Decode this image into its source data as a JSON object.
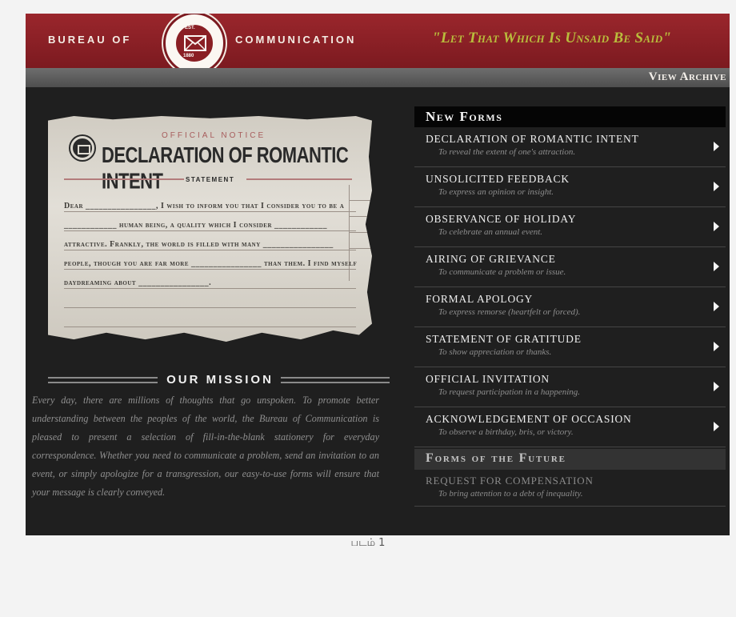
{
  "header": {
    "brand_left": "BUREAU OF",
    "brand_right": "COMMUNICATION",
    "seal": {
      "ring_text": "BUREAU OF COMMUNICATION",
      "est": "EST.",
      "year": "1880"
    },
    "motto": "\"Let That Which Is Unsaid Be Said\"",
    "view_archive": "View Archive"
  },
  "notice": {
    "official": "OFFICIAL NOTICE",
    "title": "DECLARATION OF ROMANTIC INTENT",
    "statement": "STATEMENT",
    "body": "Dear ________________, I wish to inform you that I consider you to be a ____________ human being, a quality which I consider ____________ attractive. Frankly, the world is filled with many ________________ people, though you are far more ________________ than them. I find myself daydreaming about ________________."
  },
  "mission": {
    "heading": "OUR MISSION",
    "text": "Every day, there are millions of thoughts that go unspoken. To promote better understanding between the peoples of the world, the Bureau of Communication is pleased to present a selection of fill-in-the-blank stationery for everyday correspondence. Whether you need to communicate a problem, send an invitation to an event, or simply apologize for a transgression, our easy-to-use forms will ensure that your message is clearly conveyed."
  },
  "menu": {
    "new_forms_title": "New Forms",
    "items": [
      {
        "title": "DECLARATION OF ROMANTIC INTENT",
        "desc": "To reveal the extent of one's attraction."
      },
      {
        "title": "UNSOLICITED FEEDBACK",
        "desc": "To express an opinion or insight."
      },
      {
        "title": "OBSERVANCE OF HOLIDAY",
        "desc": "To celebrate an annual event."
      },
      {
        "title": "AIRING OF GRIEVANCE",
        "desc": "To communicate a problem or issue."
      },
      {
        "title": "FORMAL APOLOGY",
        "desc": "To express remorse (heartfelt or forced)."
      },
      {
        "title": "STATEMENT OF GRATITUDE",
        "desc": "To show appreciation or thanks."
      },
      {
        "title": "OFFICIAL INVITATION",
        "desc": "To request participation in a happening."
      },
      {
        "title": "ACKNOWLEDGEMENT OF OCCASION",
        "desc": "To observe a birthday, bris, or victory."
      }
    ],
    "future_title": "Forms of the Future",
    "future_items": [
      {
        "title": "REQUEST FOR COMPENSATION",
        "desc": "To bring attention to a debt of inequality."
      }
    ]
  },
  "caption": "படம் 1"
}
